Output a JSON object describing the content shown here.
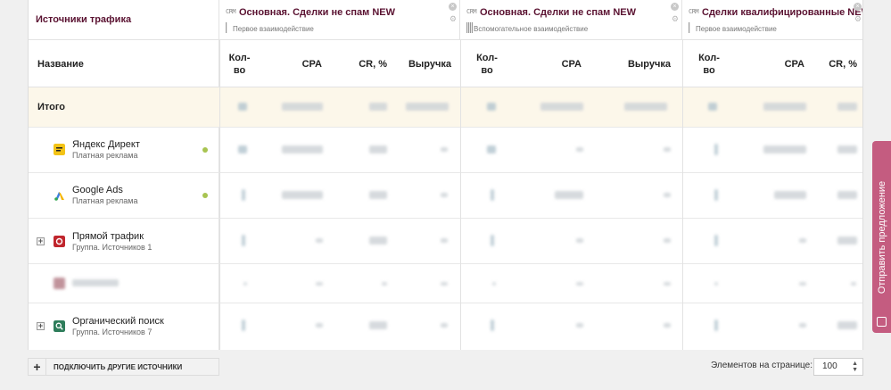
{
  "table": {
    "sources_title": "Источники трафика",
    "groups": [
      {
        "crm": "CRM",
        "title": "Основная. Сделки не спам NEW",
        "subtitle": "Первое взаимодействие"
      },
      {
        "crm": "CRM",
        "title": "Основная. Сделки не спам NEW",
        "subtitle": "Вспомогательное взаимодействие"
      },
      {
        "crm": "CRM",
        "title": "Сделки квалифицированные NEW",
        "subtitle": "Первое взаимодействие"
      }
    ],
    "columns": {
      "name": "Название",
      "count": "Кол-\nво",
      "cpa": "CPA",
      "cr": "CR, %",
      "revenue": "Выручка"
    },
    "rows": [
      {
        "type": "total",
        "name": "Итого"
      },
      {
        "type": "source",
        "name": "Яндекс Директ",
        "sub": "Платная реклама",
        "icon": "yandex-direct-icon",
        "icon_color": "#f3c316",
        "status": true
      },
      {
        "type": "source",
        "name": "Google Ads",
        "sub": "Платная реклама",
        "icon": "google-ads-icon",
        "icon_color": "#3b7fe6",
        "status": true
      },
      {
        "type": "group",
        "name": "Прямой трафик",
        "sub": "Группа. Источников 1",
        "icon": "direct-traffic-icon",
        "icon_color": "#c0262d"
      },
      {
        "type": "blurred",
        "name": ""
      },
      {
        "type": "group",
        "name": "Органический поиск",
        "sub": "Группа. Источников 7",
        "icon": "organic-search-icon",
        "icon_color": "#2e7d5b"
      }
    ]
  },
  "footer": {
    "connect_label": "ПОДКЛЮЧИТЬ ДРУГИЕ ИСТОЧНИКИ",
    "per_page_label": "Элементов на странице:",
    "per_page_value": "100"
  },
  "sidebar_tab": {
    "label": "Отправить предложение"
  },
  "colors": {
    "accent": "#5a1231",
    "total_row": "#fcf7ea",
    "feedback_tab": "#c45c80",
    "status_dot": "#a8c451"
  }
}
